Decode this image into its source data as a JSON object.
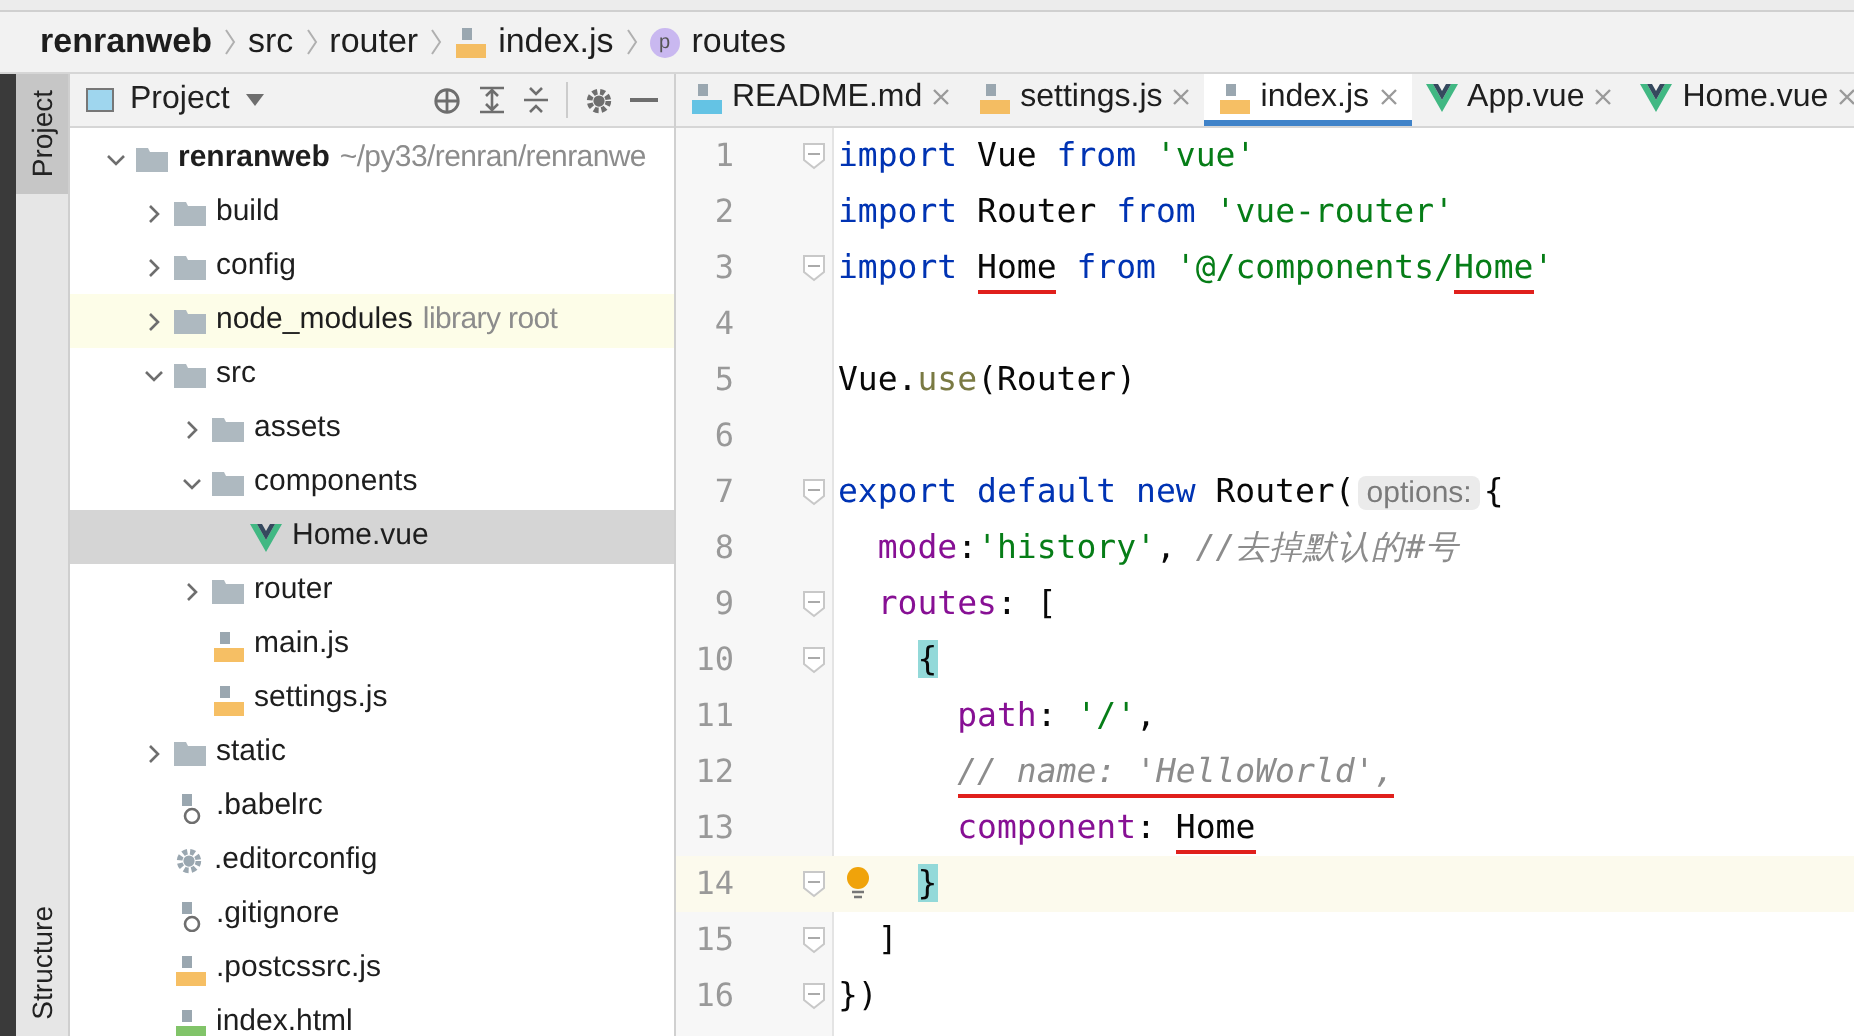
{
  "breadcrumb": [
    {
      "label": "renranweb",
      "kind": "project"
    },
    {
      "label": "src",
      "kind": "folder"
    },
    {
      "label": "router",
      "kind": "folder"
    },
    {
      "label": "index.js",
      "kind": "js"
    },
    {
      "label": "routes",
      "kind": "property",
      "badge": "p"
    }
  ],
  "side_tabs": [
    {
      "label": "Project",
      "selected": true
    },
    {
      "label": "Structure",
      "selected": false
    }
  ],
  "project_panel": {
    "title": "Project",
    "tree": [
      {
        "label": "renranweb",
        "kind": "folder",
        "bold": true,
        "note": "~/py33/renran/renranwe",
        "expanded": true,
        "selected": false,
        "children": [
          {
            "label": "build",
            "kind": "folder",
            "expanded": false,
            "selected": false
          },
          {
            "label": "config",
            "kind": "folder",
            "expanded": false,
            "selected": false
          },
          {
            "label": "node_modules",
            "kind": "library",
            "note": "library root",
            "expanded": false,
            "selected": false
          },
          {
            "label": "src",
            "kind": "folder",
            "expanded": true,
            "selected": false,
            "children": [
              {
                "label": "assets",
                "kind": "folder",
                "expanded": false,
                "selected": false
              },
              {
                "label": "components",
                "kind": "folder",
                "expanded": true,
                "selected": false,
                "children": [
                  {
                    "label": "Home.vue",
                    "kind": "vue",
                    "selected": true
                  }
                ]
              },
              {
                "label": "router",
                "kind": "folder",
                "expanded": false,
                "selected": false
              },
              {
                "label": "main.js",
                "kind": "js",
                "selected": false
              },
              {
                "label": "settings.js",
                "kind": "js",
                "selected": false
              }
            ]
          },
          {
            "label": "static",
            "kind": "folder",
            "expanded": false,
            "selected": false
          },
          {
            "label": ".babelrc",
            "kind": "babel",
            "selected": false
          },
          {
            "label": ".editorconfig",
            "kind": "config",
            "selected": false
          },
          {
            "label": ".gitignore",
            "kind": "ignore",
            "selected": false
          },
          {
            "label": ".postcssrc.js",
            "kind": "js",
            "selected": false
          },
          {
            "label": "index.html",
            "kind": "html",
            "selected": false
          }
        ]
      }
    ]
  },
  "tabs": [
    {
      "label": "README.md",
      "kind": "md",
      "selected": false
    },
    {
      "label": "settings.js",
      "kind": "js",
      "selected": false
    },
    {
      "label": "index.js",
      "kind": "js",
      "selected": true
    },
    {
      "label": "App.vue",
      "kind": "vue",
      "selected": false
    },
    {
      "label": "Home.vue",
      "kind": "vue",
      "selected": false
    }
  ],
  "editor": {
    "lines": [
      {
        "number": "1",
        "fold": true,
        "current": false,
        "bulb": false,
        "tokens": [
          {
            "text": "import ",
            "kind": "keyword"
          },
          {
            "text": "Vue ",
            "kind": "plain"
          },
          {
            "text": "from ",
            "kind": "keyword"
          },
          {
            "text": "'vue'",
            "kind": "string"
          }
        ]
      },
      {
        "number": "2",
        "fold": false,
        "current": false,
        "bulb": false,
        "tokens": [
          {
            "text": "import ",
            "kind": "keyword"
          },
          {
            "text": "Router ",
            "kind": "plain"
          },
          {
            "text": "from ",
            "kind": "keyword"
          },
          {
            "text": "'vue-router'",
            "kind": "string"
          }
        ]
      },
      {
        "number": "3",
        "fold": true,
        "current": false,
        "bulb": false,
        "tokens": [
          {
            "text": "import ",
            "kind": "keyword"
          },
          {
            "text": "Home",
            "kind": "plain",
            "underlined": true
          },
          {
            "text": " from ",
            "kind": "keyword"
          },
          {
            "text": "'@/components/",
            "kind": "string"
          },
          {
            "text": "Home",
            "kind": "string",
            "underlined": true
          },
          {
            "text": "'",
            "kind": "string"
          }
        ]
      },
      {
        "number": "4",
        "fold": false,
        "current": false,
        "bulb": false
      },
      {
        "number": "5",
        "fold": false,
        "current": false,
        "bulb": false,
        "tokens": [
          {
            "text": "Vue.",
            "kind": "plain"
          },
          {
            "text": "use",
            "kind": "method"
          },
          {
            "text": "(Router)",
            "kind": "plain"
          }
        ]
      },
      {
        "number": "6",
        "fold": false,
        "current": false,
        "bulb": false
      },
      {
        "number": "7",
        "fold": true,
        "current": false,
        "bulb": false,
        "tokens": [
          {
            "text": "export default new ",
            "kind": "keyword"
          },
          {
            "text": "Router(",
            "kind": "plain"
          },
          {
            "text": "options:",
            "kind": "hint"
          },
          {
            "text": "{",
            "kind": "plain"
          }
        ]
      },
      {
        "number": "8",
        "fold": false,
        "current": false,
        "bulb": false,
        "tokens": [
          {
            "text": "  mode",
            "kind": "property"
          },
          {
            "text": ":",
            "kind": "plain"
          },
          {
            "text": "'history'",
            "kind": "string"
          },
          {
            "text": ", ",
            "kind": "plain"
          },
          {
            "text": "//去掉默认的#号",
            "kind": "comment"
          }
        ]
      },
      {
        "number": "9",
        "fold": true,
        "current": false,
        "bulb": false,
        "tokens": [
          {
            "text": "  routes",
            "kind": "property"
          },
          {
            "text": ": [",
            "kind": "plain"
          }
        ]
      },
      {
        "number": "10",
        "fold": true,
        "current": false,
        "bulb": false,
        "tokens": [
          {
            "text": "    {",
            "kind": "brace"
          }
        ]
      },
      {
        "number": "11",
        "fold": false,
        "current": false,
        "bulb": false,
        "tokens": [
          {
            "text": "      path",
            "kind": "property"
          },
          {
            "text": ": ",
            "kind": "plain"
          },
          {
            "text": "'/'",
            "kind": "string"
          },
          {
            "text": ",",
            "kind": "plain"
          }
        ]
      },
      {
        "number": "12",
        "fold": false,
        "current": false,
        "bulb": false,
        "tokens": [
          {
            "text": "      // name: 'HelloWorld',",
            "kind": "comment",
            "underlined": true
          }
        ]
      },
      {
        "number": "13",
        "fold": false,
        "current": false,
        "bulb": false,
        "tokens": [
          {
            "text": "      component",
            "kind": "property"
          },
          {
            "text": ": ",
            "kind": "plain"
          },
          {
            "text": "Home",
            "kind": "plain",
            "underlined": true
          }
        ]
      },
      {
        "number": "14",
        "fold": true,
        "current": true,
        "bulb": true,
        "tokens": [
          {
            "text": "    }",
            "kind": "brace"
          }
        ]
      },
      {
        "number": "15",
        "fold": true,
        "current": false,
        "bulb": false,
        "tokens": [
          {
            "text": "  ]",
            "kind": "plain"
          }
        ]
      },
      {
        "number": "16",
        "fold": true,
        "current": false,
        "bulb": false,
        "tokens": [
          {
            "text": "})",
            "kind": "plain"
          }
        ]
      }
    ]
  }
}
